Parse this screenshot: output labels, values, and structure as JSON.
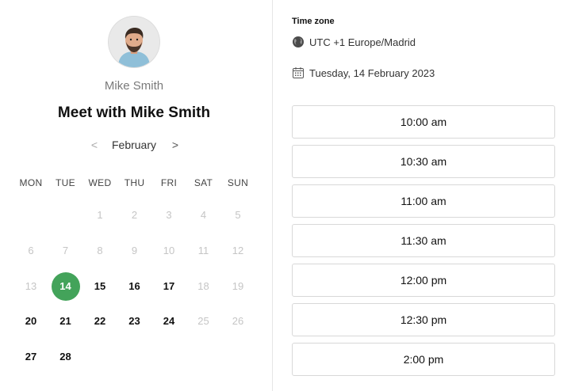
{
  "host": {
    "name": "Mike Smith",
    "avatar_icon": "person-avatar"
  },
  "title": "Meet with Mike Smith",
  "calendar": {
    "month": "February",
    "prev_icon": "<",
    "next_icon": ">",
    "weekdays": [
      "MON",
      "TUE",
      "WED",
      "THU",
      "FRI",
      "SAT",
      "SUN"
    ],
    "days": [
      {
        "n": "1",
        "state": "disabled"
      },
      {
        "n": "2",
        "state": "disabled"
      },
      {
        "n": "3",
        "state": "disabled"
      },
      {
        "n": "4",
        "state": "disabled"
      },
      {
        "n": "5",
        "state": "disabled"
      },
      {
        "n": "6",
        "state": "disabled"
      },
      {
        "n": "7",
        "state": "disabled"
      },
      {
        "n": "8",
        "state": "disabled"
      },
      {
        "n": "9",
        "state": "disabled"
      },
      {
        "n": "10",
        "state": "disabled"
      },
      {
        "n": "11",
        "state": "disabled"
      },
      {
        "n": "12",
        "state": "disabled"
      },
      {
        "n": "13",
        "state": "disabled"
      },
      {
        "n": "14",
        "state": "selected"
      },
      {
        "n": "15",
        "state": "avail"
      },
      {
        "n": "16",
        "state": "avail"
      },
      {
        "n": "17",
        "state": "avail"
      },
      {
        "n": "18",
        "state": "disabled"
      },
      {
        "n": "19",
        "state": "disabled"
      },
      {
        "n": "20",
        "state": "avail"
      },
      {
        "n": "21",
        "state": "avail"
      },
      {
        "n": "22",
        "state": "avail"
      },
      {
        "n": "23",
        "state": "avail"
      },
      {
        "n": "24",
        "state": "avail"
      },
      {
        "n": "25",
        "state": "disabled"
      },
      {
        "n": "26",
        "state": "disabled"
      },
      {
        "n": "27",
        "state": "avail"
      },
      {
        "n": "28",
        "state": "avail"
      }
    ],
    "first_weekday_index": 2,
    "selected_color": "#43a35a"
  },
  "timezone": {
    "label": "Time zone",
    "value": "UTC +1 Europe/Madrid",
    "icon": "globe-icon"
  },
  "selected_date": {
    "value": "Tuesday, 14 February 2023",
    "icon": "calendar-icon"
  },
  "slots": [
    "10:00 am",
    "10:30 am",
    "11:00 am",
    "11:30 am",
    "12:00 pm",
    "12:30 pm",
    "2:00 pm"
  ]
}
